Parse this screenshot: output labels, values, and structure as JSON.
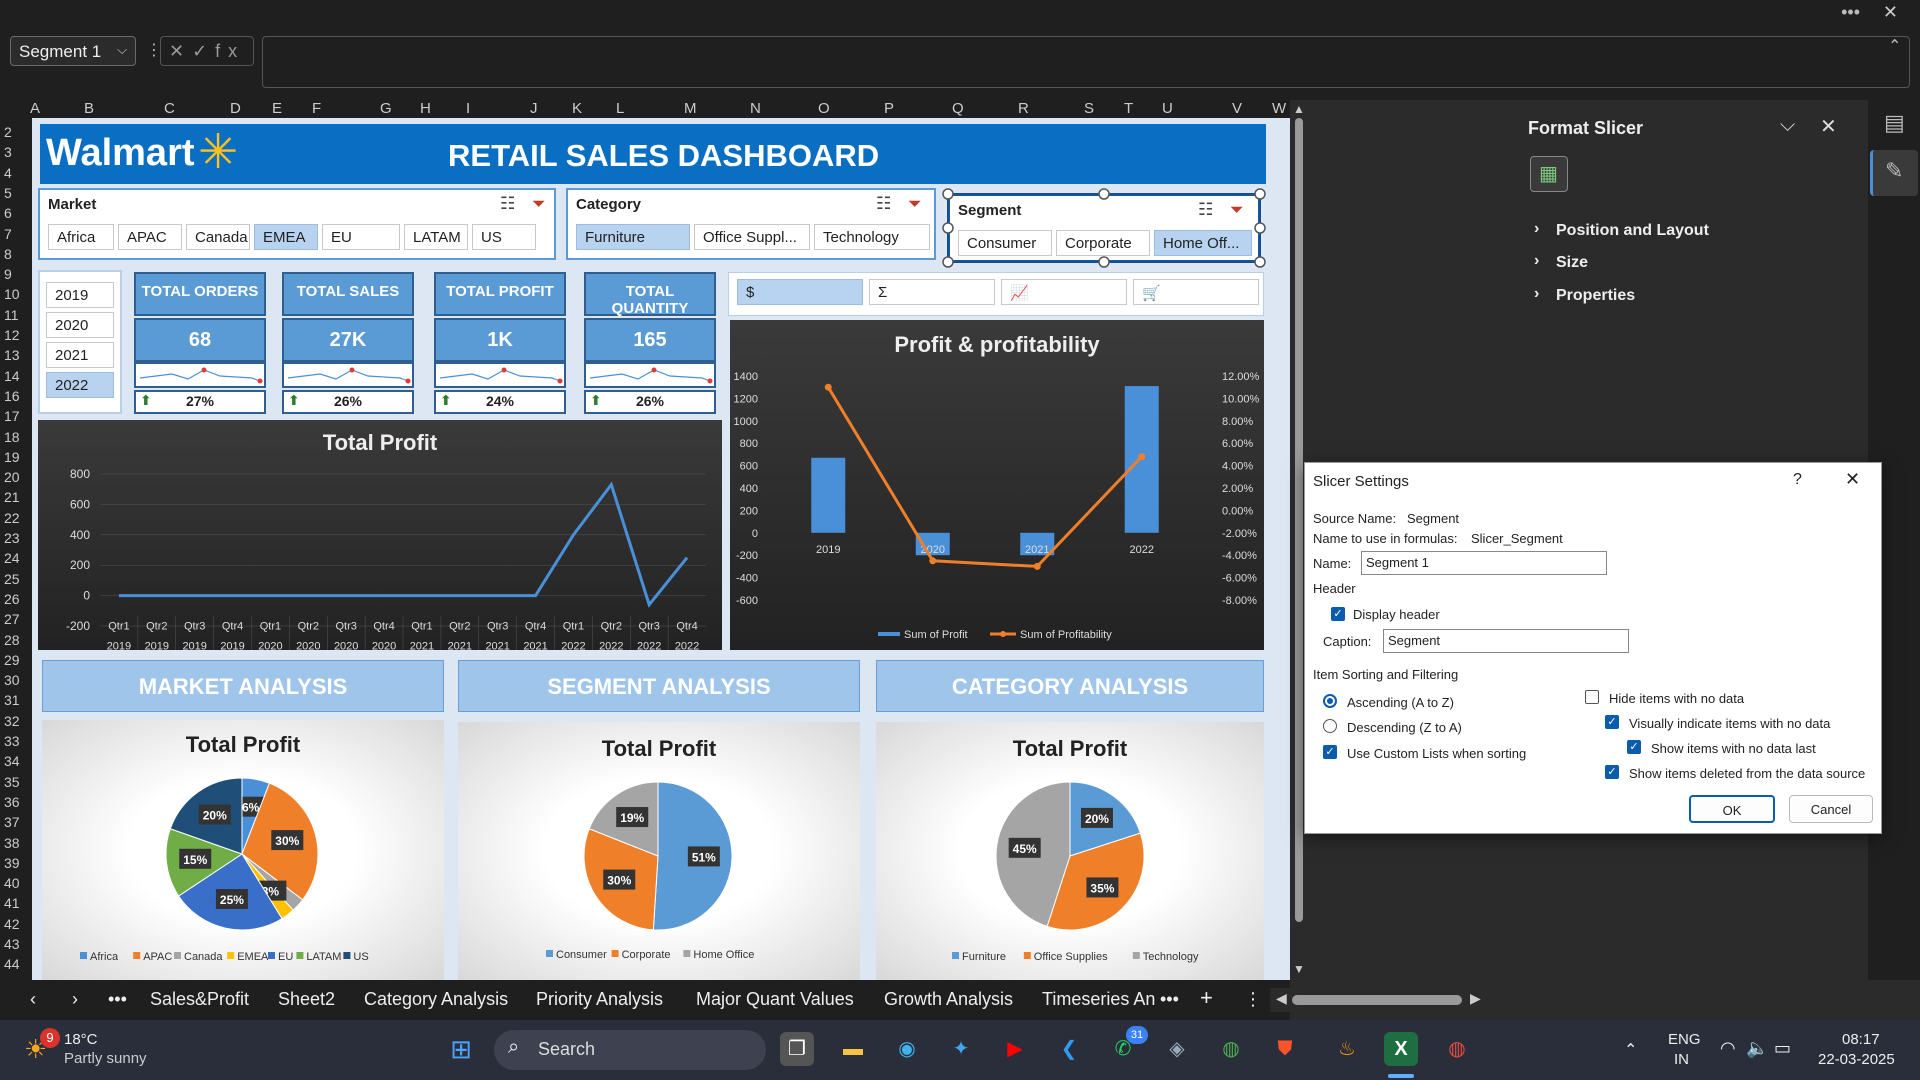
{
  "window": {
    "more_label": "•••",
    "close_label": "✕"
  },
  "formula_bar": {
    "name_box": "Segment 1",
    "fx_icons": "✕✓fx",
    "formula": ""
  },
  "columns": [
    "A",
    "B",
    "C",
    "D",
    "E",
    "F",
    "G",
    "H",
    "I",
    "J",
    "K",
    "L",
    "M",
    "N",
    "O",
    "P",
    "Q",
    "R",
    "S",
    "T",
    "U",
    "V",
    "W"
  ],
  "rows": [
    "2",
    "3",
    "4",
    "5",
    "6",
    "7",
    "8",
    "9",
    "10",
    "11",
    "12",
    "13",
    "14",
    "16",
    "17",
    "18",
    "19",
    "20",
    "21",
    "22",
    "23",
    "24",
    "25",
    "26",
    "27",
    "28",
    "29",
    "30",
    "31",
    "32",
    "33",
    "34",
    "35",
    "36",
    "37",
    "38",
    "39",
    "40",
    "41",
    "42",
    "43",
    "44"
  ],
  "dashboard": {
    "logo_text": "Walmart",
    "title": "RETAIL SALES DASHBOARD",
    "market_slicer": {
      "header": "Market",
      "items": [
        "Africa",
        "APAC",
        "Canada",
        "EMEA",
        "EU",
        "LATAM",
        "US"
      ],
      "selected": "EMEA"
    },
    "category_slicer": {
      "header": "Category",
      "items": [
        "Furniture",
        "Office Suppl...",
        "Technology"
      ],
      "selected": "Furniture"
    },
    "segment_slicer": {
      "header": "Segment",
      "items": [
        "Consumer",
        "Corporate",
        "Home Off..."
      ],
      "selected": "Home Off..."
    },
    "year_slicer": {
      "items": [
        "2019",
        "2020",
        "2021",
        "2022"
      ],
      "selected": "2022"
    },
    "kpis": [
      {
        "label": "TOTAL ORDERS",
        "value": "68",
        "pct": "27%"
      },
      {
        "label": "TOTAL SALES",
        "value": "27K",
        "pct": "26%"
      },
      {
        "label": "TOTAL PROFIT",
        "value": "1K",
        "pct": "24%"
      },
      {
        "label": "TOTAL QUANTITY",
        "value": "165",
        "pct": "26%"
      }
    ],
    "metric_slicer": {
      "items": [
        "$",
        "Σ",
        "📈",
        "🛒"
      ],
      "selected": "$"
    },
    "analysis_headers": [
      "MARKET ANALYSIS",
      "SEGMENT ANALYSIS",
      "CATEGORY ANALYSIS"
    ]
  },
  "chart_data": [
    {
      "type": "line",
      "title": "Total Profit",
      "categories": [
        "Qtr1",
        "Qtr2",
        "Qtr3",
        "Qtr4",
        "Qtr1",
        "Qtr2",
        "Qtr3",
        "Qtr4",
        "Qtr1",
        "Qtr2",
        "Qtr3",
        "Qtr4",
        "Qtr1",
        "Qtr2",
        "Qtr3",
        "Qtr4"
      ],
      "years": [
        "2019",
        "2019",
        "2019",
        "2019",
        "2020",
        "2020",
        "2020",
        "2020",
        "2021",
        "2021",
        "2021",
        "2021",
        "2022",
        "2022",
        "2022",
        "2022"
      ],
      "values": [
        0,
        0,
        0,
        0,
        0,
        0,
        0,
        0,
        0,
        0,
        0,
        0,
        400,
        730,
        -60,
        250
      ],
      "ylim": [
        -200,
        800
      ],
      "yticks": [
        -200,
        0,
        200,
        400,
        600,
        800
      ],
      "color": "#4a90d9"
    },
    {
      "type": "bar",
      "title": "Profit & profitability",
      "categories": [
        "2019",
        "2020",
        "2021",
        "2022"
      ],
      "series": [
        {
          "name": "Sum of Profit",
          "values": [
            670,
            -200,
            -200,
            1310
          ],
          "color": "#4a90d9",
          "axis": "left"
        },
        {
          "name": "Sum of Profitability",
          "values": [
            11.0,
            -4.5,
            -5.0,
            4.8
          ],
          "color": "#f07f2a",
          "axis": "right",
          "type": "line"
        }
      ],
      "ylim": [
        -600,
        1400
      ],
      "yticks": [
        -600,
        -400,
        -200,
        0,
        200,
        400,
        600,
        800,
        1000,
        1200,
        1400
      ],
      "y2lim": [
        -8,
        12
      ],
      "y2ticks": [
        "-8.00%",
        "-6.00%",
        "-4.00%",
        "-2.00%",
        "0.00%",
        "2.00%",
        "4.00%",
        "6.00%",
        "8.00%",
        "10.00%",
        "12.00%"
      ]
    },
    {
      "type": "pie",
      "title": "Total Profit",
      "categories": [
        "Africa",
        "APAC",
        "Canada",
        "EMEA",
        "EU",
        "LATAM",
        "US"
      ],
      "values": [
        6,
        30,
        3,
        3,
        25,
        15,
        20
      ],
      "labels": [
        "6%",
        "30%",
        "",
        "3%",
        "25%",
        "15%",
        "20%"
      ],
      "colors": [
        "#4a90d9",
        "#f07f2a",
        "#a5a5a5",
        "#ffc000",
        "#3a6fc9",
        "#70ad47",
        "#1f4e79"
      ]
    },
    {
      "type": "pie",
      "title": "Total Profit",
      "categories": [
        "Consumer",
        "Corporate",
        "Home Office"
      ],
      "values": [
        51,
        30,
        19
      ],
      "labels": [
        "51%",
        "30%",
        "19%"
      ],
      "colors": [
        "#5b9bd5",
        "#f07f2a",
        "#a5a5a5"
      ]
    },
    {
      "type": "pie",
      "title": "Total Profit",
      "categories": [
        "Furniture",
        "Office Supplies",
        "Technology"
      ],
      "values": [
        20,
        35,
        45
      ],
      "labels": [
        "20%",
        "35%",
        "45%"
      ],
      "colors": [
        "#5b9bd5",
        "#f07f2a",
        "#a5a5a5"
      ]
    }
  ],
  "sheet_tabs": {
    "items": [
      "Sales&Profit",
      "Sheet2",
      "Category Analysis",
      "Priority Analysis",
      "Major Quant Values",
      "Growth Analysis",
      "Timeseries An"
    ],
    "more": "•••",
    "add": "+"
  },
  "format_pane": {
    "title": "Format Slicer",
    "items": [
      "Position and Layout",
      "Size",
      "Properties"
    ]
  },
  "dialog": {
    "title": "Slicer Settings",
    "help": "?",
    "source_name_label": "Source Name:",
    "source_name": "Segment",
    "formula_name_label": "Name to use in formulas:",
    "formula_name": "Slicer_Segment",
    "name_label": "Name:",
    "name_value": "Segment 1",
    "header_section": "Header",
    "display_header": "Display header",
    "caption_label": "Caption:",
    "caption_value": "Segment",
    "sorting_section": "Item Sorting and Filtering",
    "ascending": "Ascending (A to Z)",
    "descending": "Descending (Z to A)",
    "custom_lists": "Use Custom Lists when sorting",
    "hide_no_data": "Hide items with no data",
    "visually_indicate": "Visually indicate items with no data",
    "show_no_data_last": "Show items with no data last",
    "show_deleted": "Show items deleted from the data source",
    "ok": "OK",
    "cancel": "Cancel"
  },
  "taskbar": {
    "weather_temp": "18°C",
    "weather_desc": "Partly sunny",
    "weather_badge": "9",
    "search": "Search",
    "whatsapp_badge": "31",
    "lang": "ENG",
    "region": "IN",
    "time": "08:17",
    "date": "22-03-2025"
  }
}
